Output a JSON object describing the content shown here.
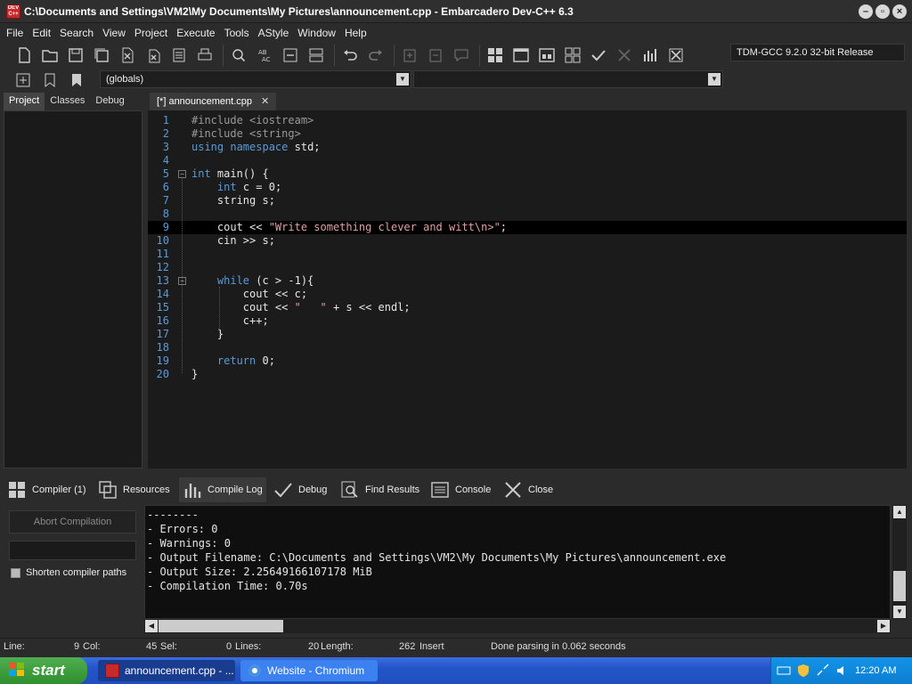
{
  "window": {
    "title": "C:\\Documents and Settings\\VM2\\My Documents\\My Pictures\\announcement.cpp - Embarcadero Dev-C++ 6.3",
    "app_icon_text": "DEV C++"
  },
  "menu": [
    "File",
    "Edit",
    "Search",
    "View",
    "Project",
    "Execute",
    "Tools",
    "AStyle",
    "Window",
    "Help"
  ],
  "toolbar": {
    "compiler": "TDM-GCC 9.2.0 32-bit Release",
    "globals": "(globals)"
  },
  "left_tabs": [
    "Project",
    "Classes",
    "Debug"
  ],
  "editor_tab": {
    "label": "[*] announcement.cpp",
    "close": "✕"
  },
  "code": [
    {
      "n": "1",
      "text": "#include <iostream>"
    },
    {
      "n": "2",
      "text": "#include <string>"
    },
    {
      "n": "3",
      "text": "using namespace std;"
    },
    {
      "n": "4",
      "text": ""
    },
    {
      "n": "5",
      "text": "int main() {"
    },
    {
      "n": "6",
      "text": "    int c = 0;"
    },
    {
      "n": "7",
      "text": "    string s;"
    },
    {
      "n": "8",
      "text": ""
    },
    {
      "n": "9",
      "text": "    cout << \"Write something clever and witt\\n>\";"
    },
    {
      "n": "10",
      "text": "    cin >> s;"
    },
    {
      "n": "11",
      "text": ""
    },
    {
      "n": "12",
      "text": ""
    },
    {
      "n": "13",
      "text": "    while (c > -1){"
    },
    {
      "n": "14",
      "text": "        cout << c;"
    },
    {
      "n": "15",
      "text": "        cout << \"   \" + s << endl;"
    },
    {
      "n": "16",
      "text": "        c++;"
    },
    {
      "n": "17",
      "text": "    }"
    },
    {
      "n": "18",
      "text": ""
    },
    {
      "n": "19",
      "text": "    return 0;"
    },
    {
      "n": "20",
      "text": "}"
    }
  ],
  "bottom_tabs": [
    "Compiler (1)",
    "Resources",
    "Compile Log",
    "Debug",
    "Find Results",
    "Console",
    "Close"
  ],
  "compile_panel": {
    "abort": "Abort Compilation",
    "shorten": "Shorten compiler paths"
  },
  "log": [
    "--------",
    "- Errors: 0",
    "- Warnings: 0",
    "- Output Filename: C:\\Documents and Settings\\VM2\\My Documents\\My Pictures\\announcement.exe",
    "- Output Size: 2.25649166107178 MiB",
    "- Compilation Time: 0.70s"
  ],
  "status": {
    "line_label": "Line:",
    "line_value": "9",
    "col_label": "Col:",
    "col_value": "45",
    "sel_label": "Sel:",
    "sel_value": "0",
    "lines_label": "Lines:",
    "lines_value": "20",
    "length_label": "Length:",
    "length_value": "262",
    "mode": "Insert",
    "message": "Done parsing in 0.062 seconds"
  },
  "taskbar": {
    "start": "start",
    "tasks": [
      "announcement.cpp - ...",
      "Website - Chromium"
    ],
    "clock": "12:20 AM"
  },
  "colors": {
    "keyword": "#5b9bd5",
    "string": "#e0a0a0",
    "editor_bg": "#1b1b1b"
  }
}
